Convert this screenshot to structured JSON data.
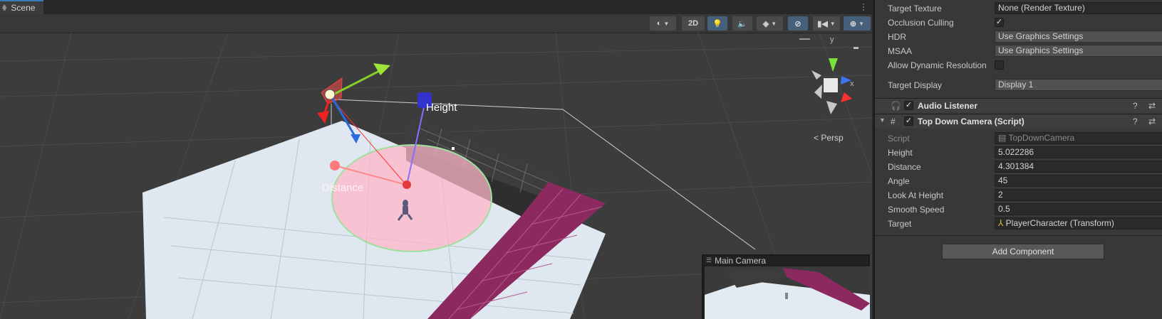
{
  "scene": {
    "tab_label": "Scene",
    "toolbar": {
      "two_d_label": "2D"
    },
    "labels": {
      "height": "Height",
      "distance": "Distance",
      "persp": "Persp"
    },
    "gizmo_axes": {
      "x": "x",
      "y": "y"
    },
    "camera_preview_title": "Main Camera"
  },
  "inspector": {
    "camera_settings": [
      {
        "label": "Target Texture",
        "value": "None (Render Texture)"
      },
      {
        "label": "Occlusion Culling",
        "checked": true
      },
      {
        "label": "HDR",
        "value": "Use Graphics Settings"
      },
      {
        "label": "MSAA",
        "value": "Use Graphics Settings"
      },
      {
        "label": "Allow Dynamic Resolution",
        "checked": false
      },
      {
        "label": "Target Display",
        "value": "Display 1"
      }
    ],
    "audio_listener": {
      "title": "Audio Listener",
      "enabled": true
    },
    "top_down_camera": {
      "title": "Top Down Camera (Script)",
      "enabled": true,
      "script": {
        "label": "Script",
        "value": "TopDownCamera"
      },
      "fields": [
        {
          "label": "Height",
          "value": "5.022286"
        },
        {
          "label": "Distance",
          "value": "4.301384"
        },
        {
          "label": "Angle",
          "value": "45"
        },
        {
          "label": "Look At Height",
          "value": "2"
        },
        {
          "label": "Smooth Speed",
          "value": "0.5"
        },
        {
          "label": "Target",
          "value": "PlayerCharacter (Transform)"
        }
      ]
    },
    "add_component_label": "Add Component"
  },
  "colors": {
    "accent_blue": "#3a79bb",
    "toggle_on": "#46607c",
    "panel": "#383838",
    "viewport_bg": "#3c3c3c"
  }
}
